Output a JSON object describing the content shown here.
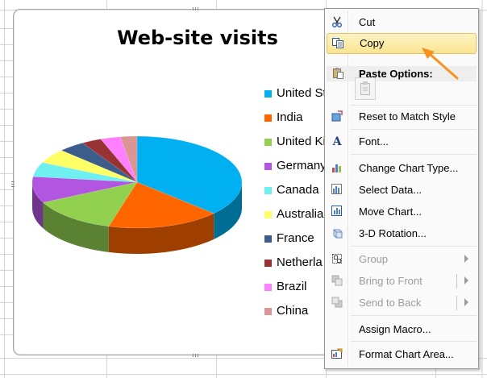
{
  "chart": {
    "title": "Web-site visits",
    "legend": [
      {
        "label": "United St",
        "color": "#00b0f0"
      },
      {
        "label": "India",
        "color": "#ff6600"
      },
      {
        "label": "United Ki",
        "color": "#92d050"
      },
      {
        "label": "Germany",
        "color": "#b255e0"
      },
      {
        "label": "Canada",
        "color": "#6ff0f0"
      },
      {
        "label": "Australia",
        "color": "#ffff66"
      },
      {
        "label": "France",
        "color": "#3c5d8c"
      },
      {
        "label": "Netherla",
        "color": "#993333"
      },
      {
        "label": "Brazil",
        "color": "#ff80ff"
      },
      {
        "label": "China",
        "color": "#d99694"
      }
    ]
  },
  "chart_data": {
    "type": "pie",
    "title": "Web-site visits",
    "categories": [
      "United St",
      "India",
      "United Ki",
      "Germany",
      "Canada",
      "Australia",
      "France",
      "Netherla",
      "Brazil",
      "China"
    ],
    "values": [
      36,
      17,
      13,
      9,
      5,
      5,
      4,
      3,
      3,
      2.5
    ]
  },
  "context_menu": {
    "items": [
      {
        "label": "Cut",
        "icon": "scissors-icon"
      },
      {
        "label": "Copy",
        "icon": "copy-icon"
      },
      {
        "label": "Paste Options:",
        "icon": "paste-icon"
      },
      {
        "label": "Reset to Match Style",
        "icon": "reset-style-icon"
      },
      {
        "label": "Font...",
        "icon": "font-icon"
      },
      {
        "label": "Change Chart Type...",
        "icon": "chart-type-icon"
      },
      {
        "label": "Select Data...",
        "icon": "select-data-icon"
      },
      {
        "label": "Move Chart...",
        "icon": "move-chart-icon"
      },
      {
        "label": "3-D Rotation...",
        "icon": "rotation-3d-icon"
      },
      {
        "label": "Group",
        "icon": "group-icon"
      },
      {
        "label": "Bring to Front",
        "icon": "bring-to-front-icon"
      },
      {
        "label": "Send to Back",
        "icon": "send-to-back-icon"
      },
      {
        "label": "Assign Macro...",
        "icon": ""
      },
      {
        "label": "Format Chart Area...",
        "icon": "format-chart-area-icon"
      }
    ]
  }
}
